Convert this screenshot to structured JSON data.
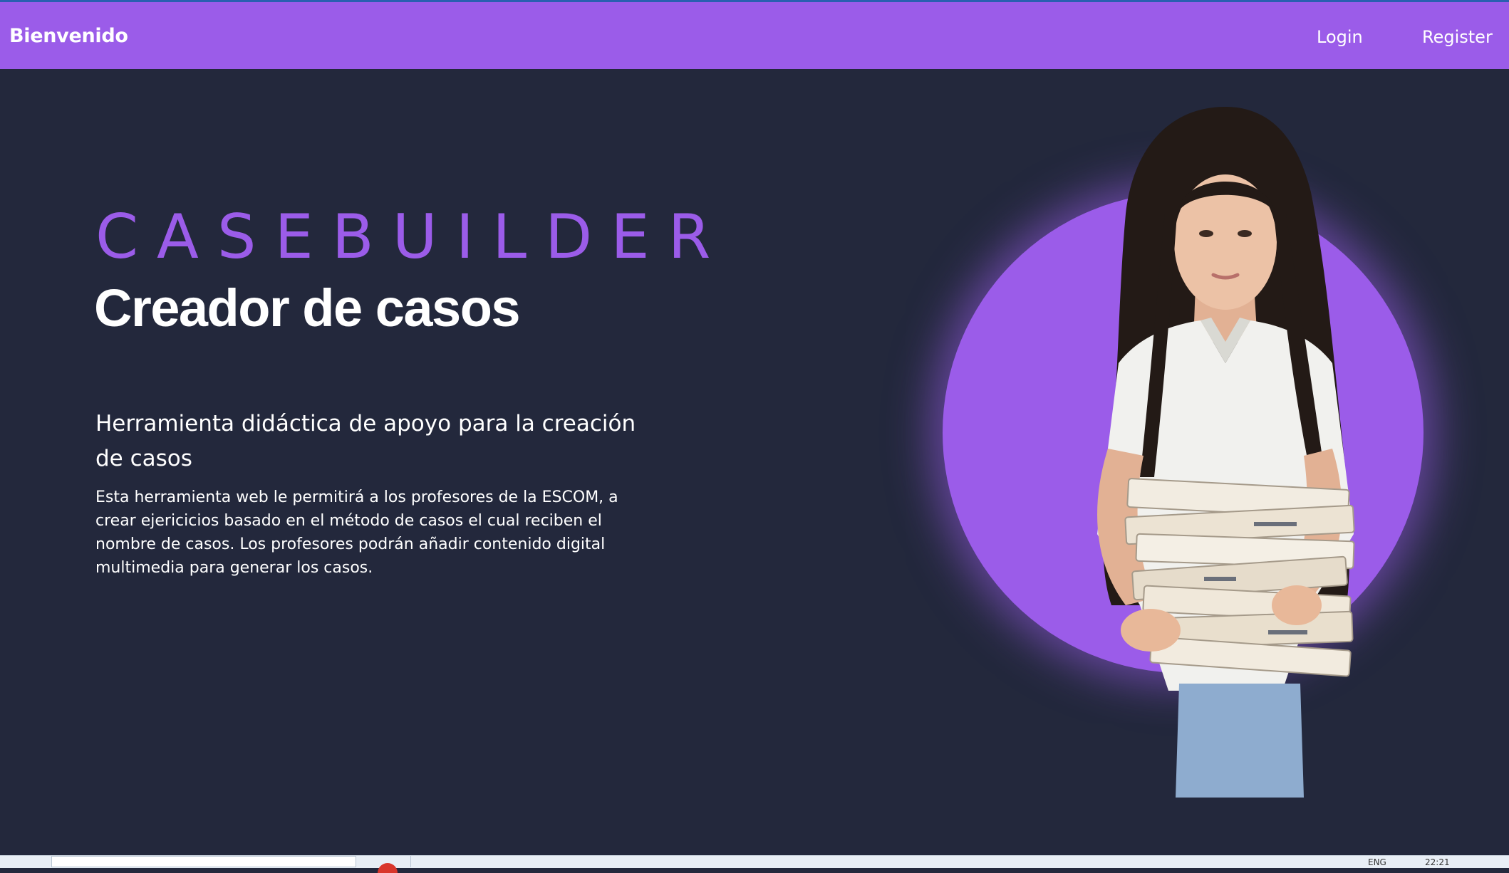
{
  "navbar": {
    "brand": "Bienvenido",
    "links": [
      {
        "label": "Login"
      },
      {
        "label": "Register"
      }
    ]
  },
  "hero": {
    "eyebrow": "CASEBUILDER",
    "title": "Creador de casos",
    "subtitle": "Herramienta didáctica de apoyo para la creación de casos",
    "description": "Esta herramienta web le permitirá a los profesores de la ESCOM, a crear ejericicios basado en el método de casos el cual reciben el nombre de casos. Los profesores podrán añadir contenido digital multimedia para generar los casos."
  },
  "taskbar": {
    "language": "ENG",
    "time": "22:21"
  },
  "colors": {
    "navbar": "#9b5ce9",
    "accent": "#9b5ce9",
    "background": "#23283c",
    "text": "#ffffff"
  }
}
